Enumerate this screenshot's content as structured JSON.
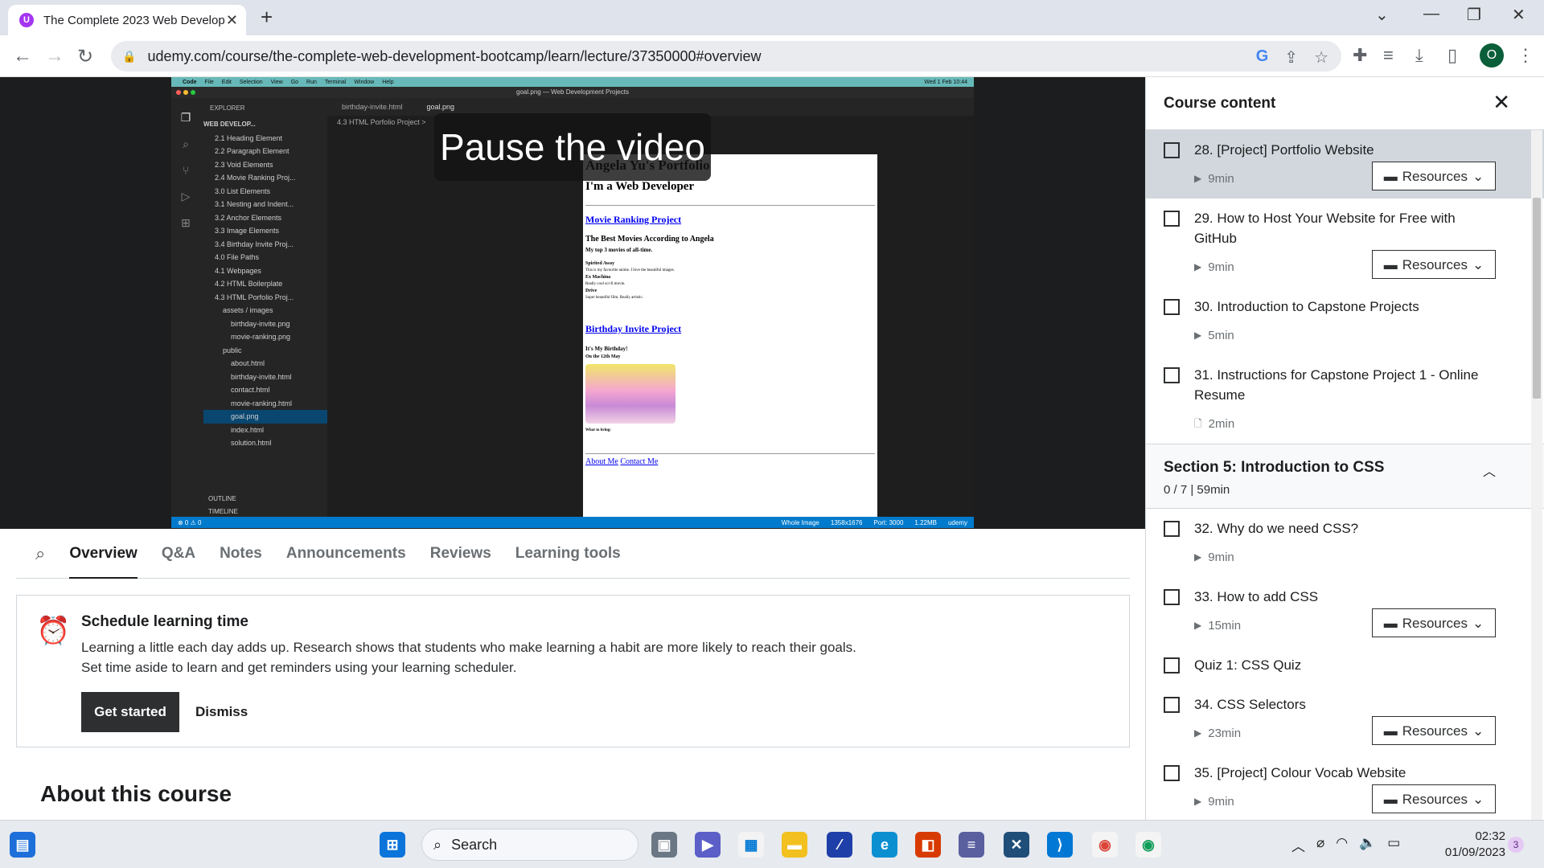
{
  "browser": {
    "tab_title": "The Complete 2023 Web Develop",
    "url": "udemy.com/course/the-complete-web-development-bootcamp/learn/lecture/37350000#overview",
    "profile_initial": "O"
  },
  "video": {
    "overlay_text": "Pause the video",
    "vscode_title": "goal.png — Web Development Projects",
    "mac_menu": [
      "Code",
      "File",
      "Edit",
      "Selection",
      "View",
      "Go",
      "Run",
      "Terminal",
      "Window",
      "Help"
    ],
    "mac_clock": "Wed 1 Feb 10:44",
    "explorer_label": "EXPLORER",
    "workspace": "WEB DEVELOP...",
    "tree": [
      "2.1 Heading Element",
      "2.2 Paragraph Element",
      "2.3 Void Elements",
      "2.4 Movie Ranking Proj...",
      "3.0 List Elements",
      "3.1 Nesting and Indent...",
      "3.2 Anchor Elements",
      "3.3 Image Elements",
      "3.4 Birthday Invite Proj...",
      "4.0 File Paths",
      "4.1 Webpages",
      "4.2 HTML Boilerplate",
      "4.3 HTML Porfolio Proj...",
      "assets / images",
      "birthday-invite.png",
      "movie-ranking.png",
      "public",
      "about.html",
      "birthday-invite.html",
      "contact.html",
      "movie-ranking.html",
      "goal.png",
      "index.html",
      "solution.html"
    ],
    "outline": "OUTLINE",
    "timeline": "TIMELINE",
    "editor_tabs": [
      "birthday-invite.html",
      "goal.png"
    ],
    "breadcrumb": "4.3 HTML Porfolio Project >",
    "preview": {
      "title": "Angela Yu's Portfolio",
      "subtitle": "I'm a Web Developer",
      "link1": "Movie Ranking Project",
      "h_movies": "The Best Movies According to Angela",
      "top3": "My top 3 movies of all-time.",
      "m1": "Spirited Away",
      "m1d": "This is my favourite anime. I love the beautiful images.",
      "m2": "Ex Machina",
      "m2d": "Really cool sci-fi movie.",
      "m3": "Drive",
      "m3d": "Super beautiful film. Really artistic.",
      "link2": "Birthday Invite Project",
      "bday": "It's My Birthday!",
      "date": "On the 12th May",
      "bring": "What to bring:",
      "footer1": "About Me",
      "footer2": "Contact Me"
    },
    "status_left": "⊗ 0 ⚠ 0",
    "status_right": [
      "Whole Image",
      "1358x1676",
      "Port: 3000",
      "1.22MB",
      "udemy"
    ]
  },
  "tabs": [
    "Overview",
    "Q&A",
    "Notes",
    "Announcements",
    "Reviews",
    "Learning tools"
  ],
  "schedule": {
    "title": "Schedule learning time",
    "line1": "Learning a little each day adds up. Research shows that students who make learning a habit are more likely to reach their goals.",
    "line2": "Set time aside to learn and get reminders using your learning scheduler.",
    "get_started": "Get started",
    "dismiss": "Dismiss"
  },
  "about_title": "About this course",
  "sidebar": {
    "title": "Course content",
    "resources_label": "Resources",
    "items_a": [
      {
        "title": "28. [Project] Portfolio Website",
        "meta": "9min",
        "res": true,
        "icon": "video"
      },
      {
        "title": "29. How to Host Your Website for Free with GitHub",
        "meta": "9min",
        "res": true,
        "icon": "video"
      },
      {
        "title": "30. Introduction to Capstone Projects",
        "meta": "5min",
        "res": false,
        "icon": "video"
      },
      {
        "title": "31. Instructions for Capstone Project 1 - Online Resume",
        "meta": "2min",
        "res": false,
        "icon": "file"
      }
    ],
    "section": {
      "title": "Section 5: Introduction to CSS",
      "sub": "0 / 7 | 59min"
    },
    "items_b": [
      {
        "title": "32. Why do we need CSS?",
        "meta": "9min",
        "res": false,
        "icon": "video"
      },
      {
        "title": "33. How to add CSS",
        "meta": "15min",
        "res": true,
        "icon": "video"
      },
      {
        "title": "Quiz 1: CSS Quiz",
        "meta": "",
        "res": false,
        "icon": ""
      },
      {
        "title": "34. CSS Selectors",
        "meta": "23min",
        "res": true,
        "icon": "video"
      },
      {
        "title": "35. [Project] Colour Vocab Website",
        "meta": "9min",
        "res": true,
        "icon": "video"
      }
    ]
  },
  "taskbar": {
    "search": "Search",
    "time": "02:32",
    "date": "01/09/2023",
    "badge": "3"
  }
}
